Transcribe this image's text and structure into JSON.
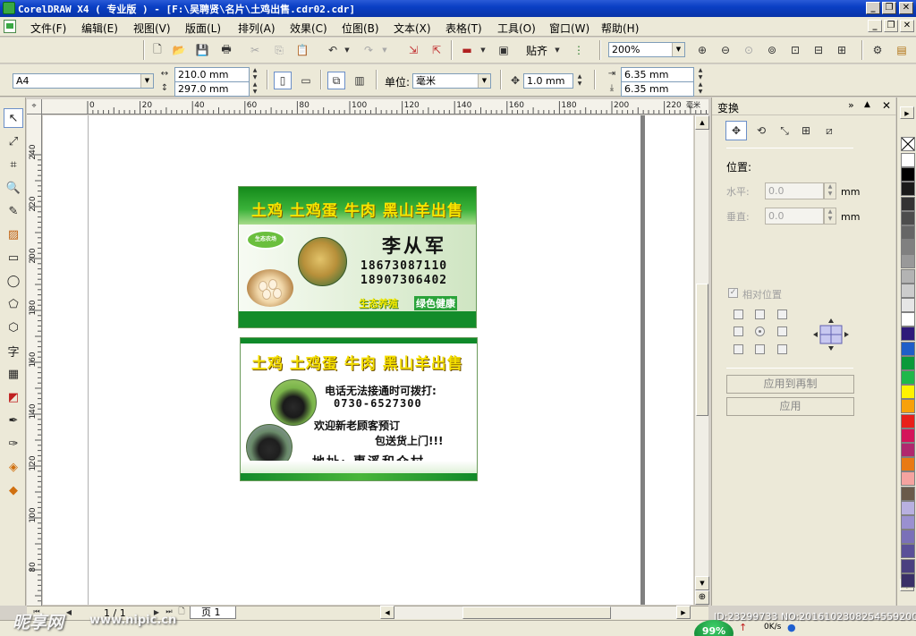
{
  "window": {
    "title": "CorelDRAW X4 ( 专业版 ) - [F:\\吴聘贤\\名片\\土鸡出售.cdr02.cdr]"
  },
  "menu": [
    "文件(F)",
    "编辑(E)",
    "视图(V)",
    "版面(L)",
    "排列(A)",
    "效果(C)",
    "位图(B)",
    "文本(X)",
    "表格(T)",
    "工具(O)",
    "窗口(W)",
    "帮助(H)"
  ],
  "toolbar": {
    "snap_label": "贴齐",
    "zoom_value": "200%"
  },
  "propbar": {
    "paper_size": "A4",
    "width": "210.0 mm",
    "height": "297.0 mm",
    "units_label": "单位:",
    "units_value": "毫米",
    "nudge": "1.0 mm",
    "dup_x": "6.35 mm",
    "dup_y": "6.35 mm"
  },
  "ruler": {
    "unit": "毫米",
    "h_ticks": [
      "0",
      "20",
      "40",
      "60",
      "80",
      "100",
      "120",
      "140",
      "160",
      "180",
      "200",
      "220"
    ],
    "v_ticks": [
      "240",
      "220",
      "200",
      "180",
      "160",
      "140",
      "120",
      "100",
      "80"
    ]
  },
  "card1": {
    "headline": "土鸡 土鸡蛋 牛肉 黑山羊出售",
    "name": "李从军",
    "phone1": "18673087110",
    "phone2": "18907306402",
    "slogan1": "生态养殖",
    "slogan2": "绿色健康"
  },
  "card2": {
    "headline": "土鸡 土鸡蛋 牛肉 黑山羊出售",
    "line1": "电话无法接通时可拨打:",
    "line2": "0730-6527300",
    "line3": "欢迎新老顾客预订",
    "line4": "包送货上门!!!",
    "address": "地址: 惠溪和众村"
  },
  "pagebar": {
    "page_count": "1 / 1",
    "page_tab": "页 1"
  },
  "docker": {
    "title": "变换",
    "position_label": "位置:",
    "h_label": "水平:",
    "v_label": "垂直:",
    "h_value": "0.0",
    "v_value": "0.0",
    "unit": "mm",
    "relative_label": "相对位置",
    "apply_dup_label": "应用到再制",
    "apply_label": "应用"
  },
  "palette": [
    "#ffffff",
    "#000000",
    "#1a1a1a",
    "#333333",
    "#4d4d4d",
    "#666666",
    "#808080",
    "#999999",
    "#b3b3b3",
    "#cccccc",
    "#e6e6e6",
    "#ffffff",
    "#2e1a7a",
    "#1f5ec8",
    "#0a9a3a",
    "#1fb84a",
    "#fff200",
    "#f7a10a",
    "#e8201a",
    "#d4145a",
    "#b0286e",
    "#e87a14",
    "#f5a3a0",
    "#6a5a4a",
    "#b8b0e0",
    "#9a90d0",
    "#7a70b8",
    "#5a5098",
    "#4a4080",
    "#3a3068"
  ],
  "status": {
    "watermark": "昵享网",
    "watermark_url": "www.nipic.cn",
    "id_text": "ID:23299733 NO:20161023082545592000",
    "net_percent": "99%",
    "net_speed": "0K/s"
  }
}
